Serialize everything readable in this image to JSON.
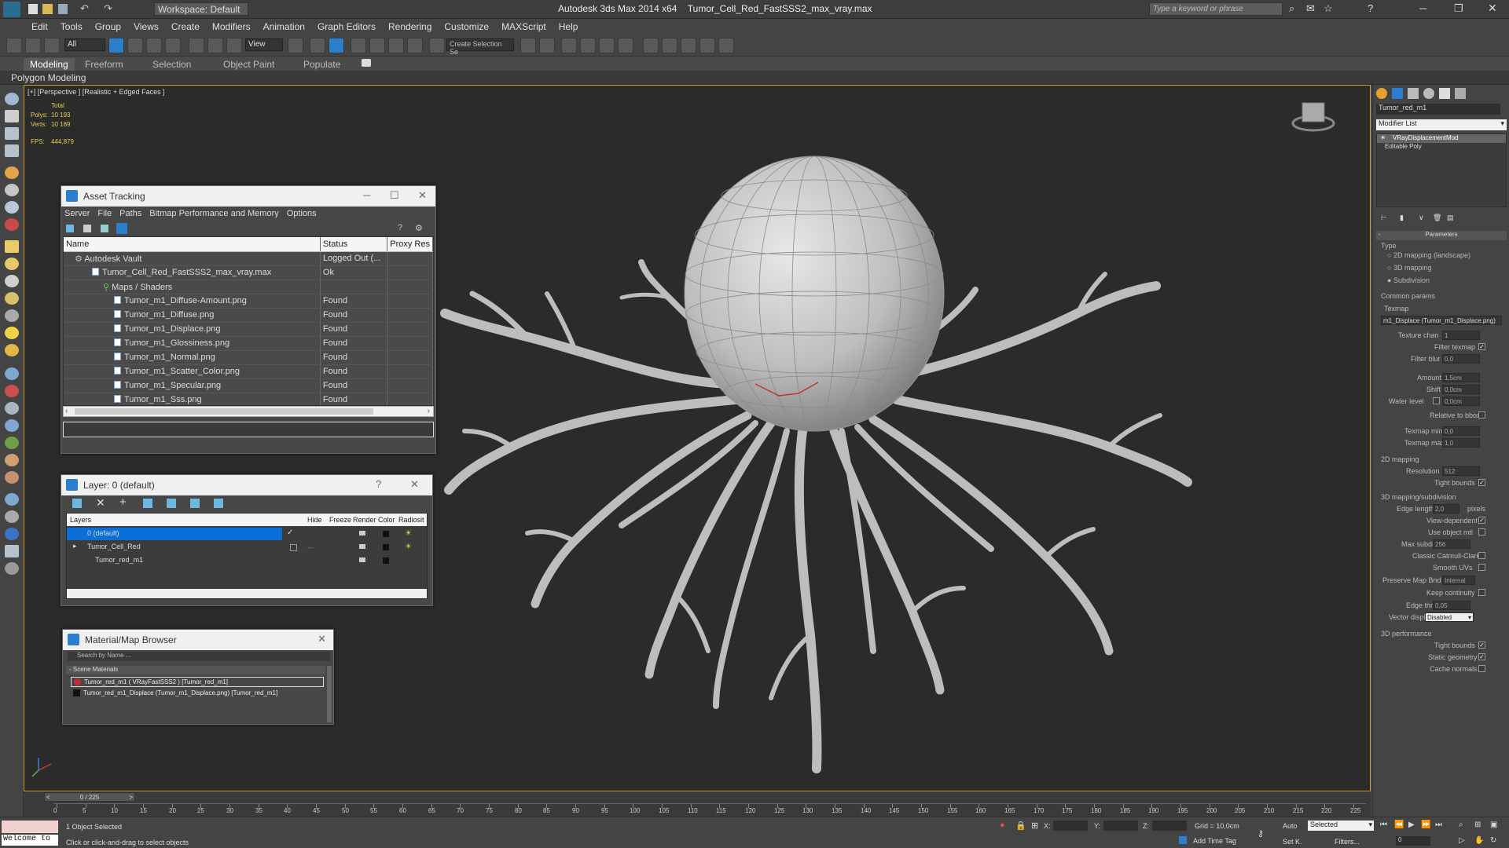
{
  "titlebar": {
    "workspace": "Workspace: Default",
    "app_title": "Autodesk 3ds Max  2014 x64",
    "file_name": "Tumor_Cell_Red_FastSSS2_max_vray.max",
    "search_placeholder": "Type a keyword or phrase"
  },
  "menu": [
    "Edit",
    "Tools",
    "Group",
    "Views",
    "Create",
    "Modifiers",
    "Animation",
    "Graph Editors",
    "Rendering",
    "Customize",
    "MAXScript",
    "Help"
  ],
  "toolbar": {
    "filter_value": "All",
    "ref_coord_value": "View",
    "selection_set_value": "Create Selection Se"
  },
  "ribbon": {
    "tabs": [
      "Modeling",
      "Freeform",
      "Selection",
      "Object Paint",
      "Populate"
    ],
    "panel_label": "Polygon Modeling"
  },
  "viewport": {
    "label": "[+] [Perspective ] [Realistic + Edged Faces ]",
    "stats": {
      "total_label": "Total",
      "polys_label": "Polys:",
      "polys_value": "10 193",
      "verts_label": "Verts:",
      "verts_value": "10 189",
      "fps_label": "FPS:",
      "fps_value": "444,879"
    }
  },
  "asset_tracking": {
    "title": "Asset Tracking",
    "menu": [
      "Server",
      "File",
      "Paths",
      "Bitmap Performance and Memory",
      "Options"
    ],
    "columns": [
      "Name",
      "Status",
      "Proxy Res"
    ],
    "rows": [
      {
        "name": "Autodesk Vault",
        "status": "Logged Out (..."
      },
      {
        "name": "Tumor_Cell_Red_FastSSS2_max_vray.max",
        "status": "Ok"
      },
      {
        "name": "Maps / Shaders",
        "status": ""
      },
      {
        "name": "Tumor_m1_Diffuse-Amount.png",
        "status": "Found"
      },
      {
        "name": "Tumor_m1_Diffuse.png",
        "status": "Found"
      },
      {
        "name": "Tumor_m1_Displace.png",
        "status": "Found"
      },
      {
        "name": "Tumor_m1_Glossiness.png",
        "status": "Found"
      },
      {
        "name": "Tumor_m1_Normal.png",
        "status": "Found"
      },
      {
        "name": "Tumor_m1_Scatter_Color.png",
        "status": "Found"
      },
      {
        "name": "Tumor_m1_Specular.png",
        "status": "Found"
      },
      {
        "name": "Tumor_m1_Sss.png",
        "status": "Found"
      }
    ]
  },
  "layer_explorer": {
    "title": "Layer: 0 (default)",
    "columns": [
      "Layers",
      "Hide",
      "Freeze",
      "Render",
      "Color",
      "Radiosit"
    ],
    "rows": [
      {
        "name": "0 (default)"
      },
      {
        "name": "Tumor_Cell_Red"
      },
      {
        "name": "Tumor_red_m1"
      }
    ]
  },
  "material_browser": {
    "title": "Material/Map Browser",
    "search_placeholder": "Search by Name ...",
    "section": "- Scene Materials",
    "items": [
      "Tumor_red_m1  ( VRayFastSSS2 ) [Tumor_red_m1]",
      "Tumor_red_m1_Displace (Tumor_m1_Displace.png) [Tumor_red_m1]"
    ]
  },
  "command_panel": {
    "object_name": "Tumor_red_m1",
    "modifier_list": "Modifier List",
    "stack": [
      "VRayDisplacementMod",
      "Editable Poly"
    ],
    "rollout": "Parameters",
    "type_label": "Type",
    "type_options": [
      "2D mapping (landscape)",
      "3D mapping",
      "Subdivision"
    ],
    "common_params": "Common params",
    "texmap_label": "Texmap",
    "texmap_value": "m1_Displace (Tumor_m1_Displace.png)",
    "texture_chan_label": "Texture chan",
    "texture_chan_value": "1",
    "filter_texmap": "Filter texmap",
    "filter_blur_label": "Filter blur",
    "filter_blur_value": "0,0",
    "amount_label": "Amount",
    "amount_value": "1,5cm",
    "shift_label": "Shift",
    "shift_value": "0,0cm",
    "water_level_label": "Water level",
    "water_level_value": "0,0cm",
    "relative_bbox": "Relative to bbox",
    "texmap_min_label": "Texmap min",
    "texmap_min_value": "0,0",
    "texmap_max_label": "Texmap max",
    "texmap_max_value": "1,0",
    "mapping_2d": "2D mapping",
    "resolution_label": "Resolution",
    "resolution_value": "512",
    "tight_bounds": "Tight bounds",
    "mapping_3d": "3D mapping/subdivision",
    "edge_length_label": "Edge length",
    "edge_length_value": "2,0",
    "pixels": "pixels",
    "view_dependent": "View-dependent",
    "use_object_mtl": "Use object mtl",
    "max_subdivs_label": "Max subdivs",
    "max_subdivs_value": "256",
    "catmull_clark": "Classic Catmull-Clark",
    "smooth_uvs": "Smooth UVs",
    "preserve_map_bnd_label": "Preserve Map Bnd",
    "preserve_map_bnd_value": "Internal",
    "keep_continuity": "Keep continuity",
    "edge_thresh_label": "Edge thresh",
    "edge_thresh_value": "0,05",
    "vector_displ_label": "Vector displ",
    "vector_displ_value": "Disabled",
    "performance_3d": "3D performance",
    "tight_bounds2": "Tight bounds",
    "static_geometry": "Static geometry",
    "cache_normals": "Cache normals"
  },
  "timeline": {
    "frame_counter": "0 / 225",
    "ticks": [
      "0",
      "5",
      "10",
      "15",
      "20",
      "25",
      "30",
      "35",
      "40",
      "45",
      "50",
      "55",
      "60",
      "65",
      "70",
      "75",
      "80",
      "85",
      "90",
      "95",
      "100",
      "105",
      "110",
      "115",
      "120",
      "125",
      "130",
      "135",
      "140",
      "145",
      "150",
      "155",
      "160",
      "165",
      "170",
      "175",
      "180",
      "185",
      "190",
      "195",
      "200",
      "205",
      "210",
      "215",
      "220",
      "225"
    ]
  },
  "status": {
    "welcome": "Welcome to",
    "selected_text": "1 Object Selected",
    "hint": "Click or click-and-drag to select objects",
    "x_label": "X:",
    "y_label": "Y:",
    "z_label": "Z:",
    "grid": "Grid = 10,0cm",
    "add_time_tag": "Add Time Tag",
    "auto": "Auto",
    "selected_dropdown": "Selected",
    "set_key": "Set K.",
    "filters": "Filters...",
    "frame_value": "0"
  },
  "colors": {
    "accent": "#2c7fcf",
    "viewport_border": "#d8a335",
    "stats_yellow": "#e8d04a",
    "material_red": "#c03030"
  }
}
